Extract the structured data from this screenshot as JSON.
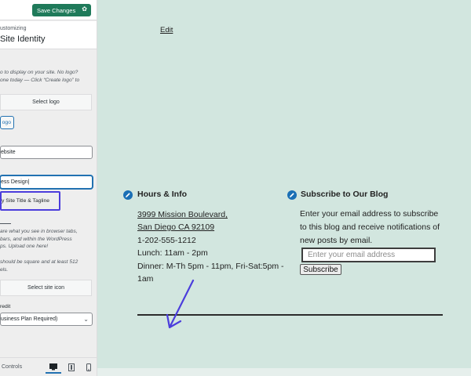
{
  "panel": {
    "save_label": "Save Changes",
    "eyebrow": "ustomizing",
    "section_title": "Site Identity",
    "logo_desc": [
      "o to display on your site. No logo?",
      "one today — Click “Create logo” to"
    ],
    "select_logo_label": "Select logo",
    "small_btn_label": "ogo",
    "site_title_label_frag": "",
    "site_title_value": "ebsite",
    "tagline_label_frag": "",
    "tagline_value": "ess Design",
    "display_title_checkbox_label": "y Site Title & Tagline",
    "icon_desc": [
      "are what you see in browser tabs,",
      "bars, and within the WordPress",
      "ps. Upload one here!"
    ],
    "icon_desc2": [
      "should be square and at least 512",
      "els."
    ],
    "select_site_icon_label": "Select site icon",
    "credit_label": "redit",
    "credit_select_value": "usiness Plan Required)",
    "footer_label": "Controls"
  },
  "preview": {
    "edit_link": "Edit",
    "hours_widget": {
      "title": "Hours & Info",
      "address_line1": "3999 Mission Boulevard,",
      "address_line2": "San Diego CA 92109",
      "phone": "1-202-555-1212",
      "lunch": "Lunch: 11am - 2pm",
      "dinner_line1": "Dinner: M-Th 5pm - 11pm, Fri-Sat:5pm -",
      "dinner_line2": "1am"
    },
    "subscribe_widget": {
      "title": "Subscribe to Our Blog",
      "description": "Enter your email address to subscribe to this blog and receive notifications of new posts by email.",
      "email_placeholder": "Enter your email address",
      "button_label": "Subscribe"
    }
  },
  "colors": {
    "preview_bg": "#d2e6df",
    "save_button": "#1f7a5a",
    "highlight_box": "#4b3ddc",
    "widget_icon": "#1a6fb5",
    "annotation_arrow": "#4b3ddc"
  }
}
